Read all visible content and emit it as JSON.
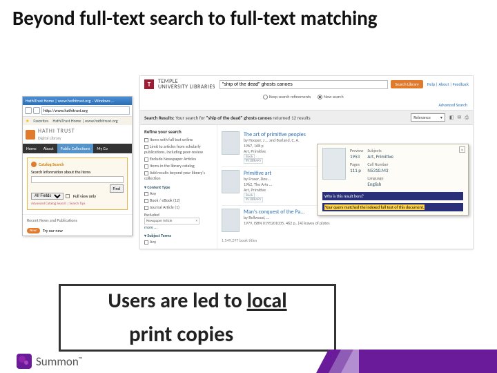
{
  "slide": {
    "title": "Beyond full-text search to full-text matching",
    "callout": "Users are led to local print copies",
    "callout_top": "Users are led to ",
    "callout_underline": "local",
    "print_copies": "print copies"
  },
  "browser": {
    "window_title": "HathiTrust Home | www.hathitrust.org – Windows ...",
    "url": "http://www.hathitrust.org",
    "favorites_label": "Favorites",
    "fav_item": "HathiTrust Home | www.hathitrust.org",
    "brand": "HATHI TRUST",
    "brand_sub": "Digital Library",
    "tabs": [
      "Home",
      "About",
      "Public Collections",
      "My Co"
    ],
    "catalog": {
      "header": "Catalog Search",
      "hint": "Search information about the items",
      "field_select": "All Fields",
      "full_view": "Full view only",
      "find": "Find",
      "links": "Advanced Catalog Search | Search Tips"
    },
    "recent": "Recent News and Publications",
    "try_badge": "New!",
    "try_text": "Try our new"
  },
  "temple": {
    "logo_letter": "T",
    "name_line1": "TEMPLE",
    "name_line2": "UNIVERSITY LIBRARIES",
    "query": "\"ship of the dead\" ghosts canoes",
    "search_btn": "Search Library",
    "help_links": "Help | About | Feedback",
    "advanced": "Advanced Search",
    "radio_keep": "Keep search refinements",
    "radio_new": "New search",
    "results_label": "Search Results:",
    "results_text_a": "Your search for ",
    "results_query": "\"ship of the dead\" ghosts canoes",
    "results_text_b": " returned 12 results",
    "sort": "Relevance",
    "icons": [
      "rss",
      "mail",
      "print"
    ],
    "refine": {
      "header": "Refine your search",
      "items_fulltext": "Items with full text online",
      "limit_scholarly": "Limit to articles from scholarly publications, including peer-review",
      "exclude_news": "Exclude Newspaper Articles",
      "in_catalog": "Items in the library catalog",
      "beyond": "Add results beyond your library's collection",
      "content_type": "▾ Content Type",
      "ct_any": "Any",
      "ct_book": "Book / eBook (12)",
      "ct_journal": "Journal Article (1)",
      "excluded": "Excluded",
      "excluded_item": "Newspaper Article",
      "more": "more ...",
      "subject": "▾ Subject Terms",
      "s_any": "Any"
    },
    "results": {
      "r1": {
        "title": "The art of primitive peoples",
        "author": "by Hooper, J ... and Burland, C. A.",
        "year": "1967, 168 p",
        "sub": "Art, Primitive",
        "tag1": "Book",
        "tag2": "IN LIBRARY"
      },
      "r2": {
        "title": "Primitive art",
        "author": "by Fraser, Dou...",
        "year": "1962, The Arts ...",
        "sub": "Art, Primitive",
        "tag1": "Book",
        "tag2": "IN LIBRARY"
      },
      "r3": {
        "title": "Man's conquest of the Pa...",
        "author": "by Bellwood, ...",
        "year": "1979, ISBN 0195201035, 462 p., [4] leaves of plates"
      },
      "stats": "1,549,297 book titles"
    },
    "popover": {
      "preview": "Preview",
      "year": "1953",
      "pages_h": "Pages",
      "pages": "111 p",
      "subjects_h": "Subjects",
      "subjects": "Art, Primitive",
      "call_h": "Call Number",
      "call": "N5310.M3",
      "lang_h": "Language",
      "lang": "English",
      "why_h": "Why is this result here?",
      "match": "Your query matched the indexed full text of this document."
    }
  },
  "footer": {
    "brand": "Summon"
  }
}
